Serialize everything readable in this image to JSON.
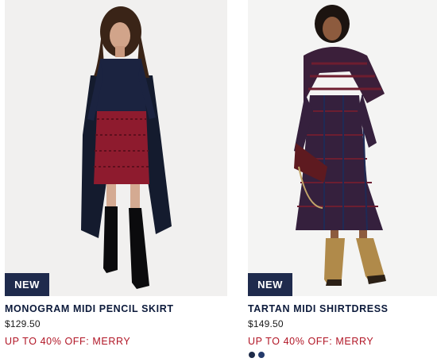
{
  "products": [
    {
      "badge": "NEW",
      "name": "MONOGRAM MIDI PENCIL SKIRT",
      "price": "$129.50",
      "promo": "UP TO 40% OFF: MERRY",
      "image": "model in navy shirt, red monogram pencil skirt, long navy coat, black knee boots"
    },
    {
      "badge": "NEW",
      "name": "TARTAN MIDI SHIRTDRESS",
      "price": "$149.50",
      "promo": "UP TO 40% OFF: MERRY",
      "image": "model in purple tartan shirtdress with scarf, burgundy chain bag, gold lace-up boots",
      "swatches": [
        "#1e2b48",
        "#243a6b"
      ]
    }
  ],
  "colors": {
    "badge_bg": "#1f2b4d",
    "title": "#0c1a3b",
    "promo": "#b11626"
  }
}
